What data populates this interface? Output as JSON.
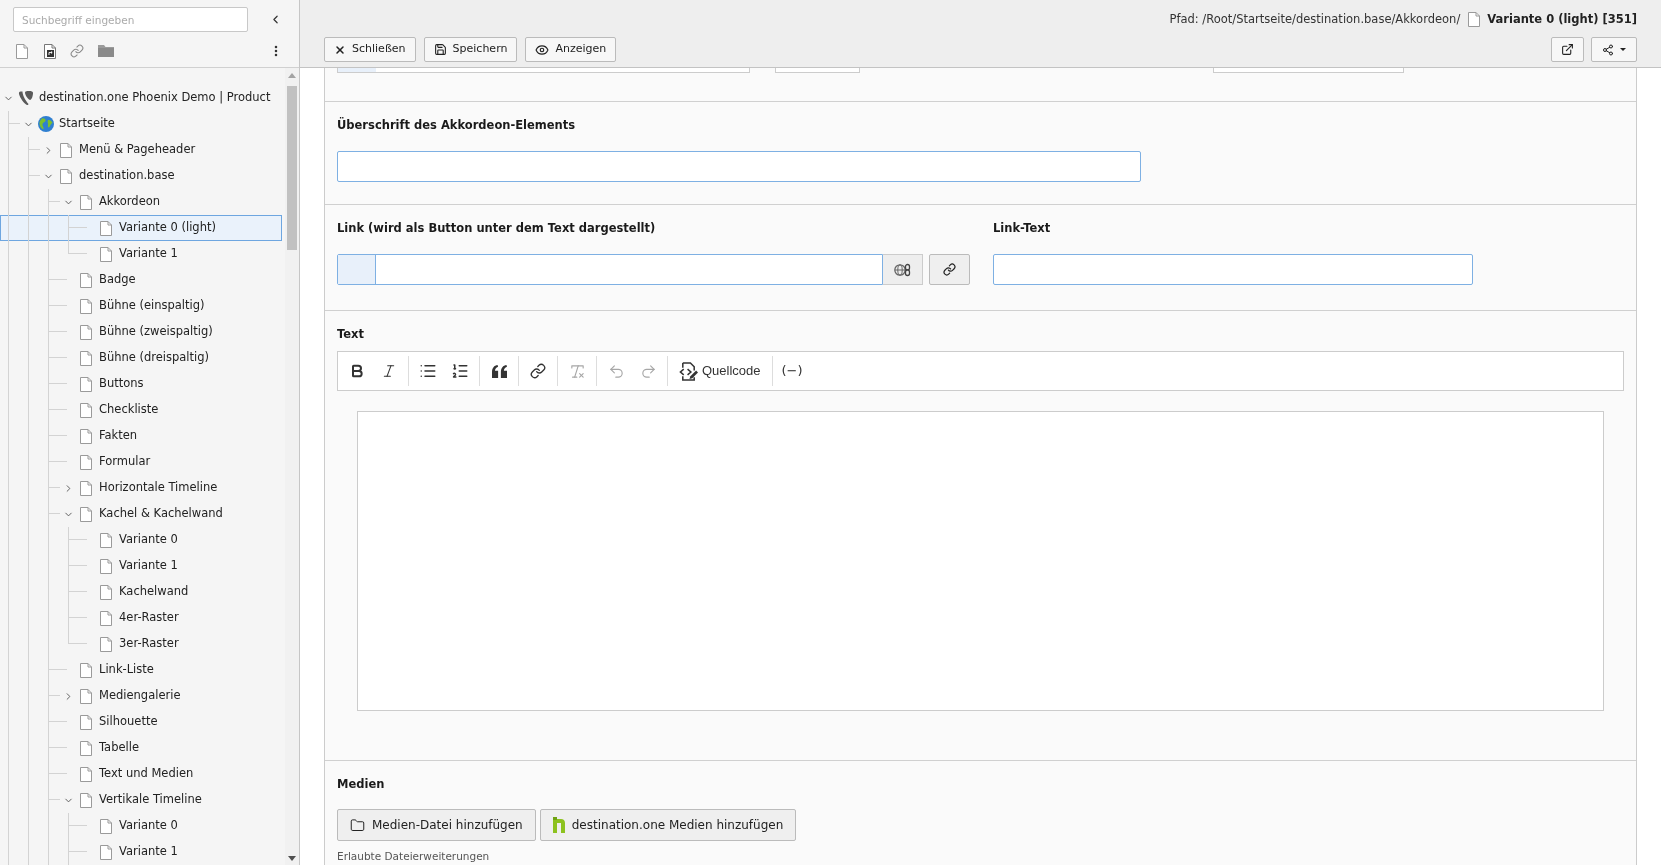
{
  "sidebar": {
    "search": {
      "placeholder": "Suchbegriff eingeben"
    },
    "tree": [
      {
        "label": "destination.one Phoenix Demo | Product",
        "kind": "root",
        "expandable": true,
        "expanded": true,
        "selected": false,
        "children": [
          {
            "label": "Startseite",
            "kind": "site",
            "expandable": true,
            "expanded": true,
            "selected": false,
            "children": [
              {
                "label": "Menü & Pageheader",
                "kind": "page",
                "expandable": true,
                "expanded": false,
                "selected": false
              },
              {
                "label": "destination.base",
                "kind": "page",
                "expandable": true,
                "expanded": true,
                "selected": false,
                "children": [
                  {
                    "label": "Akkordeon",
                    "kind": "page",
                    "expandable": true,
                    "expanded": true,
                    "selected": false,
                    "children": [
                      {
                        "label": "Variante 0 (light)",
                        "kind": "page",
                        "expandable": false,
                        "expanded": false,
                        "selected": true
                      },
                      {
                        "label": "Variante 1",
                        "kind": "page",
                        "expandable": false,
                        "expanded": false,
                        "selected": false
                      }
                    ]
                  },
                  {
                    "label": "Badge",
                    "kind": "page",
                    "expandable": false,
                    "expanded": false,
                    "selected": false
                  },
                  {
                    "label": "Bühne (einspaltig)",
                    "kind": "page",
                    "expandable": false,
                    "expanded": false,
                    "selected": false
                  },
                  {
                    "label": "Bühne (zweispaltig)",
                    "kind": "page",
                    "expandable": false,
                    "expanded": false,
                    "selected": false
                  },
                  {
                    "label": "Bühne (dreispaltig)",
                    "kind": "page",
                    "expandable": false,
                    "expanded": false,
                    "selected": false
                  },
                  {
                    "label": "Buttons",
                    "kind": "page",
                    "expandable": false,
                    "expanded": false,
                    "selected": false
                  },
                  {
                    "label": "Checkliste",
                    "kind": "page",
                    "expandable": false,
                    "expanded": false,
                    "selected": false
                  },
                  {
                    "label": "Fakten",
                    "kind": "page",
                    "expandable": false,
                    "expanded": false,
                    "selected": false
                  },
                  {
                    "label": "Formular",
                    "kind": "page",
                    "expandable": false,
                    "expanded": false,
                    "selected": false
                  },
                  {
                    "label": "Horizontale Timeline",
                    "kind": "page",
                    "expandable": true,
                    "expanded": false,
                    "selected": false
                  },
                  {
                    "label": "Kachel & Kachelwand",
                    "kind": "page",
                    "expandable": true,
                    "expanded": true,
                    "selected": false,
                    "children": [
                      {
                        "label": "Variante 0",
                        "kind": "page",
                        "expandable": false,
                        "expanded": false,
                        "selected": false
                      },
                      {
                        "label": "Variante 1",
                        "kind": "page",
                        "expandable": false,
                        "expanded": false,
                        "selected": false
                      },
                      {
                        "label": "Kachelwand",
                        "kind": "page",
                        "expandable": false,
                        "expanded": false,
                        "selected": false
                      },
                      {
                        "label": "4er-Raster",
                        "kind": "page",
                        "expandable": false,
                        "expanded": false,
                        "selected": false
                      },
                      {
                        "label": "3er-Raster",
                        "kind": "page",
                        "expandable": false,
                        "expanded": false,
                        "selected": false
                      }
                    ]
                  },
                  {
                    "label": "Link-Liste",
                    "kind": "page",
                    "expandable": false,
                    "expanded": false,
                    "selected": false
                  },
                  {
                    "label": "Mediengalerie",
                    "kind": "page",
                    "expandable": true,
                    "expanded": false,
                    "selected": false
                  },
                  {
                    "label": "Silhouette",
                    "kind": "page",
                    "expandable": false,
                    "expanded": false,
                    "selected": false
                  },
                  {
                    "label": "Tabelle",
                    "kind": "page",
                    "expandable": false,
                    "expanded": false,
                    "selected": false
                  },
                  {
                    "label": "Text und Medien",
                    "kind": "page",
                    "expandable": false,
                    "expanded": false,
                    "selected": false
                  },
                  {
                    "label": "Vertikale Timeline",
                    "kind": "page",
                    "expandable": true,
                    "expanded": true,
                    "selected": false,
                    "children": [
                      {
                        "label": "Variante 0",
                        "kind": "page",
                        "expandable": false,
                        "expanded": false,
                        "selected": false
                      },
                      {
                        "label": "Variante 1",
                        "kind": "page",
                        "expandable": false,
                        "expanded": false,
                        "selected": false
                      }
                    ]
                  }
                ]
              }
            ]
          }
        ]
      }
    ]
  },
  "header": {
    "path": "Pfad: /Root/Startseite/destination.base/Akkordeon/",
    "title": "Variante 0 (light) [351]",
    "buttons": [
      {
        "kind": "close",
        "label": "Schließen"
      },
      {
        "kind": "save",
        "label": "Speichern"
      },
      {
        "kind": "view",
        "label": "Anzeigen"
      }
    ]
  },
  "form": {
    "sections": [
      {
        "fields": [
          {
            "kind": "text",
            "label": "Überschrift des Akkordeon-Elements"
          }
        ]
      },
      {
        "fields": [
          {
            "kind": "link",
            "label": "Link (wird als Button unter dem Text dargestellt)"
          },
          {
            "kind": "text",
            "label": "Link-Text"
          }
        ]
      },
      {
        "fields": [
          {
            "kind": "rich-text",
            "label": "Text",
            "toolbar": [
              [
                {
                  "kind": "bold",
                  "disabled": false
                },
                {
                  "kind": "italic",
                  "disabled": false
                }
              ],
              [
                {
                  "kind": "bulleted-list",
                  "disabled": false
                },
                {
                  "kind": "numbered-list",
                  "disabled": false
                }
              ],
              [
                {
                  "kind": "quote",
                  "disabled": false
                }
              ],
              [
                {
                  "kind": "link",
                  "disabled": false
                }
              ],
              [
                {
                  "kind": "remove-format",
                  "disabled": true
                }
              ],
              [
                {
                  "kind": "undo",
                  "disabled": true
                },
                {
                  "kind": "redo",
                  "disabled": true
                }
              ],
              [
                {
                  "kind": "source",
                  "label": "Quellcode",
                  "disabled": false
                }
              ],
              [
                {
                  "kind": "soft-hyphen",
                  "label": "(−)",
                  "disabled": false
                }
              ]
            ]
          }
        ]
      },
      {
        "fields": [
          {
            "kind": "media",
            "label": "Medien",
            "buttons": [
              {
                "kind": "folder",
                "label": "Medien-Datei hinzufügen"
              },
              {
                "kind": "destination-one",
                "label": "destination.one Medien hinzufügen"
              }
            ],
            "note": "Erlaubte Dateierweiterungen"
          }
        ]
      }
    ]
  }
}
